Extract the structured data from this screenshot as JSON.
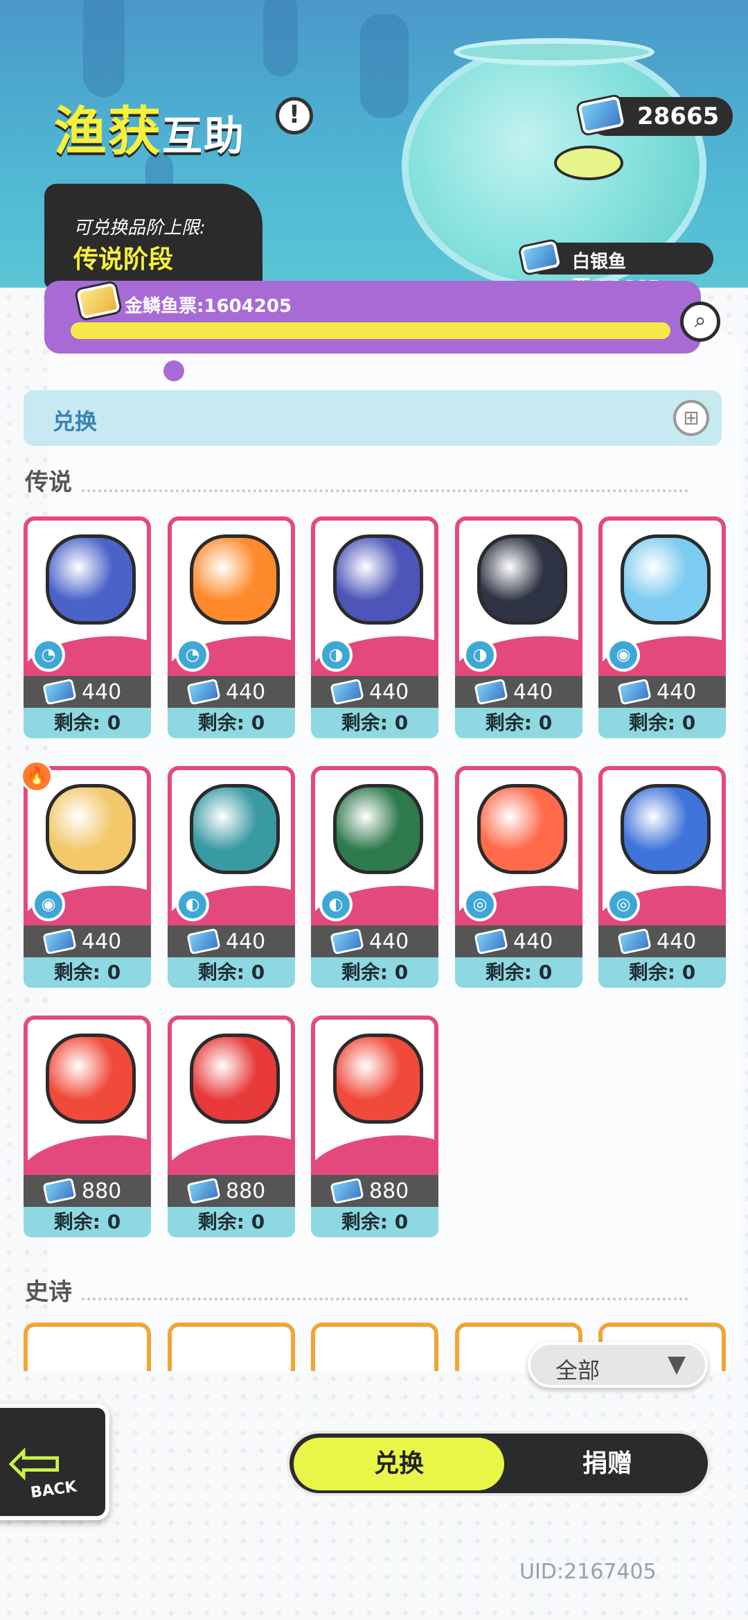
{
  "header": {
    "title_main": "渔获",
    "title_sub": "互助",
    "info_icon": "exclamation-icon",
    "exchange_limit_label": "可兑换品阶上限:",
    "exchange_limit_value": "传说阶段",
    "blue_tickets": "28665",
    "silver_tickets": "白银鱼票:28665",
    "gold_tickets": "金鳞鱼票:1604205",
    "gold_progress": 1.0
  },
  "exchange_bar": {
    "label": "兑换",
    "icon": "gift-icon"
  },
  "sections": [
    {
      "title": "传说"
    },
    {
      "title": "史诗"
    }
  ],
  "legend_items": [
    {
      "price": "440",
      "remain": "剩余: 0",
      "type": "fish",
      "art": "#4a63c9"
    },
    {
      "price": "440",
      "remain": "剩余: 0",
      "type": "fish",
      "art": "#ff8a2b"
    },
    {
      "price": "440",
      "remain": "剩余: 0",
      "type": "bird",
      "art": "#4d55b8"
    },
    {
      "price": "440",
      "remain": "剩余: 0",
      "type": "bird",
      "art": "#2f3445"
    },
    {
      "price": "440",
      "remain": "剩余: 0",
      "type": "shell",
      "art": "#7ccbf0"
    },
    {
      "price": "440",
      "remain": "剩余: 0",
      "type": "shell",
      "art": "#f2c86a",
      "hot": true
    },
    {
      "price": "440",
      "remain": "剩余: 0",
      "type": "egg",
      "art": "#3a9aa3"
    },
    {
      "price": "440",
      "remain": "剩余: 0",
      "type": "egg",
      "art": "#2f7a4d"
    },
    {
      "price": "440",
      "remain": "剩余: 0",
      "type": "spiral",
      "art": "#ff6a4a"
    },
    {
      "price": "440",
      "remain": "剩余: 0",
      "type": "spiral",
      "art": "#3f74d9"
    },
    {
      "price": "880",
      "remain": "剩余: 0",
      "type": "",
      "art": "#f04a3a"
    },
    {
      "price": "880",
      "remain": "剩余: 0",
      "type": "",
      "art": "#e83a3a"
    },
    {
      "price": "880",
      "remain": "剩余: 0",
      "type": "",
      "art": "#f04a3a"
    }
  ],
  "filter": {
    "label": "全部",
    "icon": "chevron-down-icon"
  },
  "back": {
    "label": "BACK",
    "icon": "arrow-left-icon"
  },
  "tabs": {
    "active": "兑换",
    "inactive": "捐赠"
  },
  "uid": "UID:2167405"
}
